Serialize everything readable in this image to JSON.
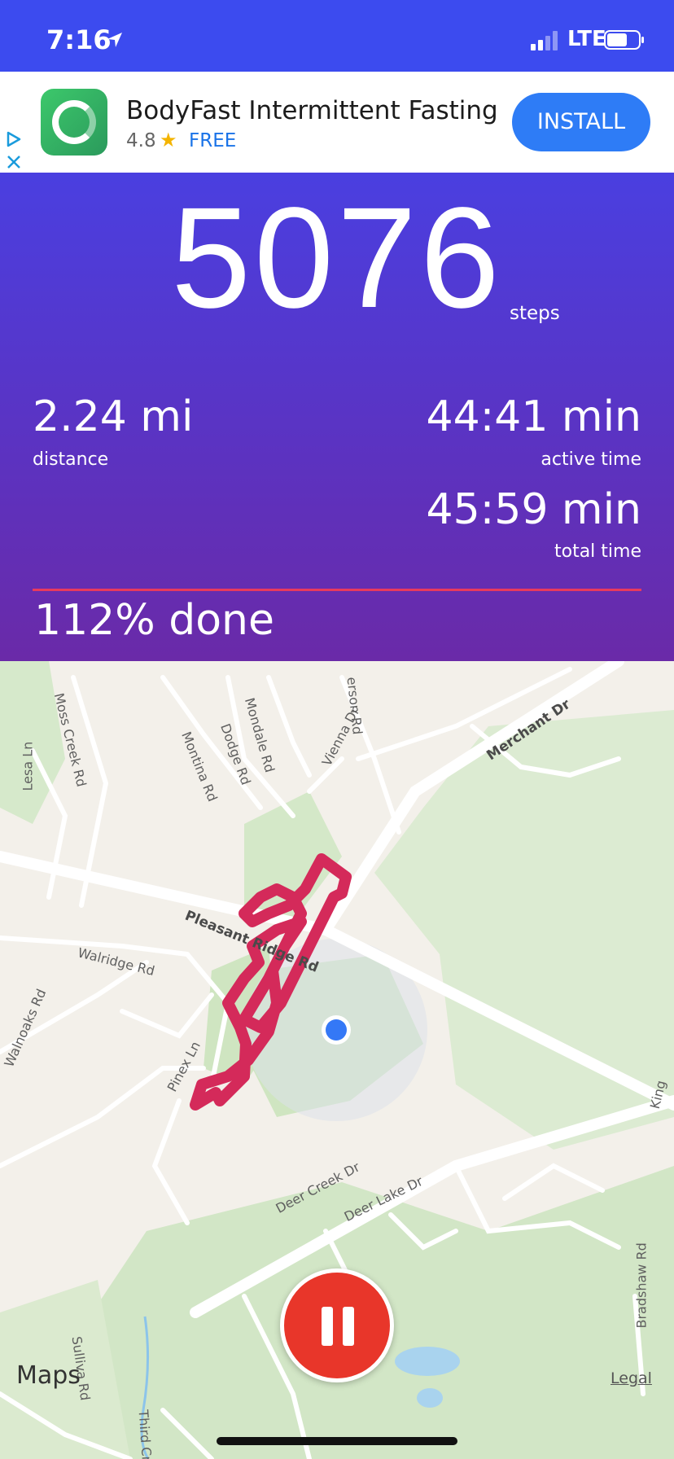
{
  "status_bar": {
    "time": "7:16",
    "network": "LTE"
  },
  "ad": {
    "title": "BodyFast Intermittent Fasting",
    "rating": "4.8",
    "price": "FREE",
    "install_label": "INSTALL"
  },
  "stats": {
    "steps": "5076",
    "steps_unit": "steps",
    "distance": "2.24 mi",
    "distance_label": "distance",
    "active_time": "44:41 min",
    "active_time_label": "active time",
    "total_time": "45:59 min",
    "total_time_label": "total time",
    "progress_text": "112% done",
    "progress_fraction": 1.0
  },
  "map": {
    "street_labels": [
      "Moss Creek Rd",
      "Lesa Ln",
      "Montina Rd",
      "Dodge Rd",
      "Mondale Rd",
      "Vienna Dr",
      "erson Rd",
      "Merchant Dr",
      "Pleasant Ridge Rd",
      "Walridge Rd",
      "Walnoaks Rd",
      "Pinex Ln",
      "Deer Creek Dr",
      "Deer Lake Dr",
      "Bradshaw Rd",
      "Sulliva  Rd",
      "Third Cr",
      "King"
    ],
    "attribution": "Maps",
    "legal": "Legal"
  },
  "colors": {
    "status_bar": "#3c4bef",
    "panel_top": "#4a3fe0",
    "panel_bottom": "#6a2aa8",
    "route": "#d42a5a",
    "progress": "#e83a5e",
    "pause_button": "#e8362a",
    "install_button": "#2e7cf6"
  }
}
